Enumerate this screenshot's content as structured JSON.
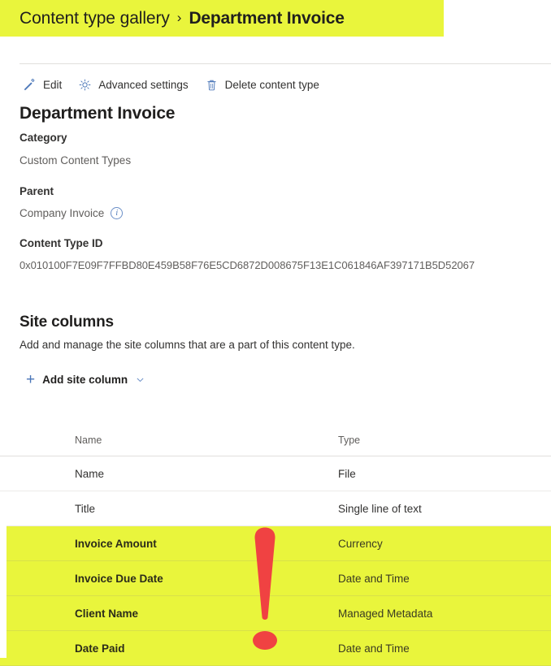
{
  "breadcrumb": {
    "parent": "Content type gallery",
    "separator": "›",
    "current": "Department Invoice"
  },
  "commandbar": {
    "items": [
      {
        "label": "Edit",
        "icon": "pencil-icon"
      },
      {
        "label": "Advanced settings",
        "icon": "gear-icon"
      },
      {
        "label": "Delete content type",
        "icon": "trash-icon"
      }
    ]
  },
  "details": {
    "title": "Department Invoice",
    "category_label": "Category",
    "category_value": "Custom Content Types",
    "parent_label": "Parent",
    "parent_value": "Company Invoice",
    "parent_info_icon": "info-icon",
    "content_type_id_label": "Content Type ID",
    "content_type_id_value": "0x010100F7E09F7FFBD80E459B58F76E5CD6872D008675F13E1C061846AF397171B5D52067"
  },
  "site_columns": {
    "title": "Site columns",
    "description": "Add and manage the site columns that are a part of this content type.",
    "add_button_label": "Add site column",
    "add_button_icon": "plus-icon",
    "add_button_chevron": "chevron-down-icon",
    "headers": [
      "Name",
      "Type"
    ],
    "rows": [
      {
        "name": "Name",
        "type": "File",
        "highlighted": false
      },
      {
        "name": "Title",
        "type": "Single line of text",
        "highlighted": false
      },
      {
        "name": "Invoice Amount",
        "type": "Currency",
        "highlighted": true
      },
      {
        "name": "Invoice Due Date",
        "type": "Date and Time",
        "highlighted": true
      },
      {
        "name": "Client Name",
        "type": "Managed Metadata",
        "highlighted": true
      },
      {
        "name": "Date Paid",
        "type": "Date and Time",
        "highlighted": true
      }
    ]
  },
  "annotations": {
    "exclamation_mark": "red-exclamation-mark",
    "highlight_color": "#e9f53c",
    "annotation_color": "#f04242",
    "accent_color": "#4a76b8"
  }
}
